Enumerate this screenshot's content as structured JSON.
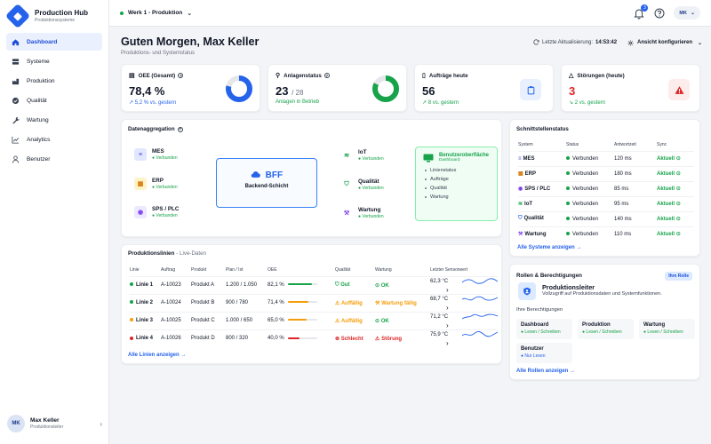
{
  "brand": {
    "title": "Production Hub",
    "subtitle": "Produktionssysteme"
  },
  "sidebar": {
    "items": [
      {
        "label": "Dashboard",
        "icon": "home-icon"
      },
      {
        "label": "Systeme",
        "icon": "server-icon"
      },
      {
        "label": "Produktion",
        "icon": "factory-icon"
      },
      {
        "label": "Qualität",
        "icon": "check-badge-icon"
      },
      {
        "label": "Wartung",
        "icon": "wrench-icon"
      },
      {
        "label": "Analytics",
        "icon": "chart-icon"
      },
      {
        "label": "Benutzer",
        "icon": "user-icon"
      }
    ],
    "user": {
      "initials": "MK",
      "name": "Max Keller",
      "role": "Produktionsleiter"
    }
  },
  "topbar": {
    "site": "Werk 1 - Produktion",
    "notifications": "3",
    "user_initials": "MK"
  },
  "header": {
    "greeting": "Guten Morgen, Max Keller",
    "subtitle": "Produktions- und Systemstatus",
    "last_update_label": "Letzte Aktualisierung:",
    "last_update_time": "14:53:42",
    "view_button": "Ansicht konfigurieren"
  },
  "kpis": {
    "oee": {
      "title": "OEE (Gesamt)",
      "value": "78,4 %",
      "trend": "5,2 % vs. gestern",
      "fraction": 0.784
    },
    "plants": {
      "title": "Anlagenstatus",
      "value": "23",
      "total": "/ 28",
      "trend": "Anlagen in Betrieb",
      "fraction": 0.82
    },
    "orders": {
      "title": "Aufträge heute",
      "value": "56",
      "trend": "8 vs. gestern"
    },
    "faults": {
      "title": "Störungen (heute)",
      "value": "3",
      "trend": "2 vs. gestern"
    }
  },
  "aggregation": {
    "title": "Datenaggregation",
    "sources": [
      {
        "name": "MES",
        "status": "● Verbunden"
      },
      {
        "name": "ERP",
        "status": "● Verbunden"
      },
      {
        "name": "SPS / PLC",
        "status": "● Verbunden"
      }
    ],
    "bff": {
      "title": "BFF",
      "subtitle": "Backend-Schicht"
    },
    "services": [
      {
        "name": "IoT",
        "status": "● Verbunden"
      },
      {
        "name": "Qualität",
        "status": "● Verbunden"
      },
      {
        "name": "Wartung",
        "status": "● Verbunden"
      }
    ],
    "frontend": {
      "title": "Benutzeroberfläche",
      "subtitle": "Dashboard",
      "items": [
        "Linienstatus",
        "Aufträge",
        "Qualität",
        "Wartung"
      ]
    }
  },
  "interfaces": {
    "title": "Schnittstellenstatus",
    "headers": [
      "System",
      "Status",
      "Antwortzeit",
      "Sync"
    ],
    "rows": [
      {
        "system": "MES",
        "status": "Verbunden",
        "time": "120 ms",
        "sync": "Aktuell"
      },
      {
        "system": "ERP",
        "status": "Verbunden",
        "time": "180 ms",
        "sync": "Aktuell"
      },
      {
        "system": "SPS / PLC",
        "status": "Verbunden",
        "time": "85 ms",
        "sync": "Aktuell"
      },
      {
        "system": "IoT",
        "status": "Verbunden",
        "time": "95 ms",
        "sync": "Aktuell"
      },
      {
        "system": "Qualität",
        "status": "Verbunden",
        "time": "140 ms",
        "sync": "Aktuell"
      },
      {
        "system": "Wartung",
        "status": "Verbunden",
        "time": "110 ms",
        "sync": "Aktuell"
      }
    ],
    "link": "Alle Systeme anzeigen"
  },
  "lines": {
    "title": "Produktionslinien",
    "subtitle": "- Live-Daten",
    "headers": [
      "Linie",
      "Auftrag",
      "Produkt",
      "Plan / Ist",
      "OEE",
      "Qualität",
      "Wartung",
      "Letzter Sensorwert"
    ],
    "rows": [
      {
        "line": "Linie 1",
        "order": "A-10023",
        "product": "Produkt A",
        "plan": "1.200 / 1.050",
        "oee": "82,1 %",
        "oee_fraction": 0.821,
        "quality": "Gut",
        "maintenance": "OK",
        "sensor": "62,3 °C",
        "dot": "#16a34a",
        "q_class": "st-green",
        "m_class": "st-green",
        "bar": "#16a34a"
      },
      {
        "line": "Linie 2",
        "order": "A-10024",
        "product": "Produkt B",
        "plan": "900 / 780",
        "oee": "71,4 %",
        "oee_fraction": 0.714,
        "quality": "Auffällig",
        "maintenance": "Wartung fällig",
        "sensor": "68,7 °C",
        "dot": "#16a34a",
        "q_class": "st-orange",
        "m_class": "st-orange",
        "bar": "#f59e0b"
      },
      {
        "line": "Linie 3",
        "order": "A-10025",
        "product": "Produkt C",
        "plan": "1.000 / 650",
        "oee": "65,0 %",
        "oee_fraction": 0.65,
        "quality": "Auffällig",
        "maintenance": "OK",
        "sensor": "71,2 °C",
        "dot": "#f59e0b",
        "q_class": "st-orange",
        "m_class": "st-green",
        "bar": "#f59e0b"
      },
      {
        "line": "Linie 4",
        "order": "A-10026",
        "product": "Produkt D",
        "plan": "800 / 320",
        "oee": "40,0 %",
        "oee_fraction": 0.4,
        "quality": "Schlecht",
        "maintenance": "Störung",
        "sensor": "75,9 °C",
        "dot": "#dc2626",
        "q_class": "st-red",
        "m_class": "st-red",
        "bar": "#dc2626"
      }
    ],
    "link": "Alle Linien anzeigen"
  },
  "roles": {
    "title": "Rollen & Berechtigungen",
    "badge": "Ihre Rolle",
    "role_name": "Produktionsleiter",
    "role_desc": "Vollzugriff auf Produktionsdaten und Systemfunktionen.",
    "perms_title": "Ihre Berechtigungen",
    "perms": [
      {
        "name": "Dashboard",
        "rights": "● Lesen / Schreiben"
      },
      {
        "name": "Produktion",
        "rights": "● Lesen / Schreiben"
      },
      {
        "name": "Wartung",
        "rights": "● Lesen / Schreiben"
      },
      {
        "name": "Benutzer",
        "rights": "● Nur Lesen"
      }
    ],
    "link": "Alle Rollen anzeigen"
  },
  "colors": {
    "accent": "#2563eb",
    "success": "#16a34a",
    "warning": "#f59e0b",
    "danger": "#dc2626"
  }
}
